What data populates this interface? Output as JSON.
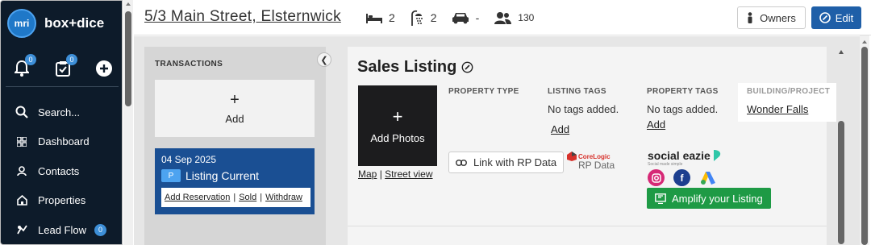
{
  "sidebar": {
    "logo_text": "mri",
    "brand": "box+dice",
    "notifications_badge": "0",
    "tasks_badge": "0",
    "nav": [
      {
        "label": "Search...",
        "icon": "search-icon"
      },
      {
        "label": "Dashboard",
        "icon": "dashboard-icon"
      },
      {
        "label": "Contacts",
        "icon": "contacts-icon"
      },
      {
        "label": "Properties",
        "icon": "properties-icon"
      },
      {
        "label": "Lead Flow",
        "icon": "lead-flow-icon",
        "badge": "0"
      }
    ]
  },
  "header": {
    "address": "5/3 Main Street, Elsternwick",
    "bedrooms": "2",
    "bathrooms": "2",
    "car_spaces": "-",
    "contacts": "130",
    "owners_label": "Owners",
    "edit_label": "Edit"
  },
  "transactions": {
    "title": "TRANSACTIONS",
    "add_symbol": "+",
    "add_label": "Add",
    "card": {
      "date": "04 Sep 2025",
      "badge": "P",
      "status": "Listing Current",
      "actions": [
        "Add Reservation",
        "Sold",
        "Withdraw"
      ]
    }
  },
  "listing": {
    "title": "Sales Listing",
    "add_photos_symbol": "+",
    "add_photos_label": "Add Photos",
    "map_link": "Map",
    "street_view_link": "Street view",
    "link_separator": "|",
    "property_type_head": "PROPERTY TYPE",
    "listing_tags_head": "LISTING TAGS",
    "listing_tags_value": "No tags added.",
    "listing_tags_add": "Add",
    "property_tags_head": "PROPERTY TAGS",
    "property_tags_value": "No tags added.",
    "property_tags_add": "Add",
    "building_head": "BUILDING/PROJECT",
    "building_value": "Wonder Falls",
    "rp_button": "Link with RP Data",
    "corelogic_top": "CoreLogic",
    "corelogic_bottom": "RP Data",
    "social_eazie": "social eazie",
    "social_eazie_sub": "Social made simple",
    "amplify_button": "Amplify your Listing"
  },
  "colors": {
    "sidebar_bg": "#0d1b2a",
    "accent_blue": "#1f5fa8",
    "card_blue": "#1a4f93",
    "amplify_green": "#1e9a45"
  }
}
